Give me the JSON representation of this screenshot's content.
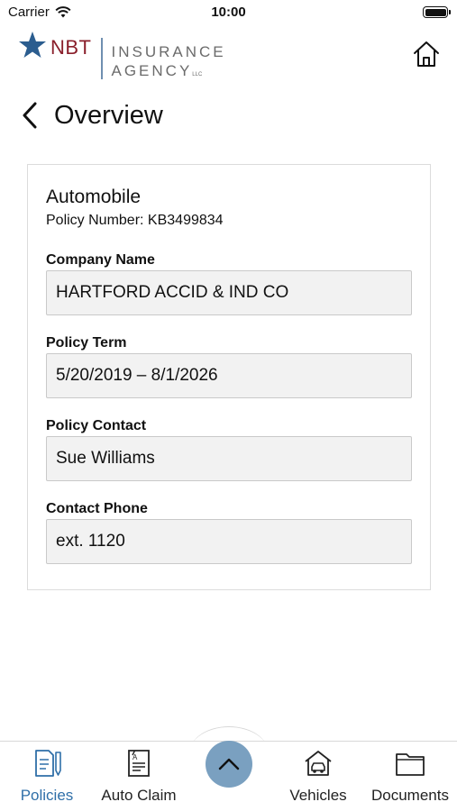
{
  "status_bar": {
    "carrier": "Carrier",
    "time": "10:00"
  },
  "header": {
    "logo": {
      "brand": "NBT",
      "line1": "INSURANCE",
      "line2": "AGENCY",
      "suffix": "LLC"
    },
    "home_icon": "home-icon"
  },
  "page": {
    "title": "Overview",
    "back_icon": "chevron-left-icon"
  },
  "policy": {
    "type": "Automobile",
    "number_text": "Policy Number: KB3499834",
    "fields": [
      {
        "label": "Company Name",
        "value": "HARTFORD ACCID & IND CO"
      },
      {
        "label": "Policy Term",
        "value": "5/20/2019 – 8/1/2026"
      },
      {
        "label": "Policy Contact",
        "value": "Sue Williams"
      },
      {
        "label": "Contact Phone",
        "value": "ext. 1120"
      }
    ]
  },
  "tab_bar": {
    "tabs": [
      {
        "label": "Policies",
        "icon": "document-pen-icon",
        "active": true
      },
      {
        "label": "Auto Claim",
        "icon": "claim-form-icon",
        "active": false
      },
      {
        "label": "Vehicles",
        "icon": "car-garage-icon",
        "active": false
      },
      {
        "label": "Documents",
        "icon": "folder-icon",
        "active": false
      }
    ],
    "center_icon": "chevron-up-icon"
  },
  "colors": {
    "accent": "#2f6fa8",
    "brand_red": "#8a1f2b",
    "center_button": "#7aa0c0"
  }
}
